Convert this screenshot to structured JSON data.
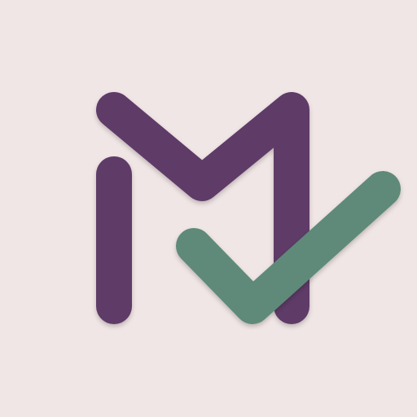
{
  "logo": {
    "icon": "m-checkmark-logo-icon",
    "colors": {
      "background": "#F1E6E6",
      "m_stroke": "#5E3A67",
      "check_stroke": "#5F8A79",
      "shadow": "#000000"
    },
    "letter": "M"
  }
}
